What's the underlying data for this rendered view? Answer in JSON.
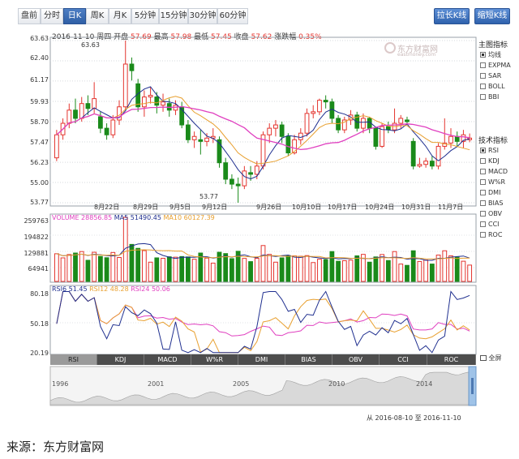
{
  "toolbar": {
    "period_tabs": [
      "盘前",
      "分时",
      "日K",
      "周K",
      "月K",
      "5分钟",
      "15分钟",
      "30分钟",
      "60分钟"
    ],
    "active_tab": "日K",
    "stretch_button": "拉长K线",
    "shorten_button": "缩短K线"
  },
  "ticker": {
    "date": "2016-11-10",
    "weekday": "周四",
    "open_label": "开盘",
    "open": "57.69",
    "high_label": "最高",
    "high": "57.98",
    "low_label": "最低",
    "low": "57.45",
    "close_label": "收盘",
    "close": "57.62",
    "change_label": "涨跌幅",
    "change": "0.35%"
  },
  "watermark": {
    "brand": "东方财富网",
    "domain": "eastmoney.com"
  },
  "price_axis": [
    "63.63",
    "62.40",
    "61.17",
    "59.93",
    "58.70",
    "57.47",
    "56.23",
    "55.00",
    "53.77"
  ],
  "price_annotations": {
    "high": "63.63",
    "low": "53.77"
  },
  "date_axis": [
    "8月22日",
    "8月29日",
    "9月5日",
    "9月12日",
    "9月26日",
    "10月10日",
    "10月17日",
    "10月24日",
    "10月31日",
    "11月7日"
  ],
  "volume_legend": {
    "volume": "VOLUME 28856.85",
    "ma5": "MA5 51490.45",
    "ma10": "MA10 60127.39"
  },
  "volume_axis": [
    "259763",
    "194822",
    "129881",
    "64941"
  ],
  "rsi_legend": {
    "rsi6": "RSI6 51.45",
    "rsi12": "RSI12 48.28",
    "rsi24": "RSI24 50.06"
  },
  "rsi_axis": [
    "80.18",
    "50.18",
    "20.19"
  ],
  "indicator_tabs": [
    "RSI",
    "KDJ",
    "MACD",
    "W%R",
    "DMI",
    "BIAS",
    "OBV",
    "CCI",
    "ROC"
  ],
  "active_indicator": "RSI",
  "fullscreen_label": "全屏",
  "overview_years": [
    "1996",
    "2001",
    "2005",
    "2010",
    "2014"
  ],
  "date_range": {
    "from_label": "从",
    "from": "2016-08-10",
    "to_label": "至",
    "to": "2016-11-10"
  },
  "main_indicators": {
    "title": "主图指标",
    "items": [
      "均线",
      "EXPMA",
      "SAR",
      "BOLL",
      "BBI"
    ],
    "selected": "均线"
  },
  "tech_indicators": {
    "title": "技术指标",
    "items": [
      "RSI",
      "KDJ",
      "MACD",
      "W%R",
      "DMI",
      "BIAS",
      "OBV",
      "CCI",
      "ROC"
    ],
    "selected": "RSI"
  },
  "source_caption": "来源：东方财富网",
  "colors": {
    "up": "#e4352f",
    "down": "#1a8a1a",
    "accent": "#2f5fa6",
    "ma5": "#1f2f8f",
    "ma10": "#e8a030",
    "ma20": "#e040c0"
  },
  "chart_data": {
    "type": "candlestick",
    "price_range": [
      53.77,
      63.63
    ],
    "candles": [
      {
        "o": 56.5,
        "c": 57.9,
        "h": 58.2,
        "l": 56.3
      },
      {
        "o": 57.9,
        "c": 58.6,
        "h": 58.9,
        "l": 57.6
      },
      {
        "o": 58.6,
        "c": 59.4,
        "h": 59.8,
        "l": 58.3
      },
      {
        "o": 59.4,
        "c": 58.9,
        "h": 60.1,
        "l": 58.6
      },
      {
        "o": 58.9,
        "c": 59.8,
        "h": 60.2,
        "l": 58.7
      },
      {
        "o": 59.8,
        "c": 59.5,
        "h": 60.3,
        "l": 59.1
      },
      {
        "o": 59.5,
        "c": 60.1,
        "h": 61.1,
        "l": 59.2
      },
      {
        "o": 59.0,
        "c": 58.3,
        "h": 59.3,
        "l": 58.0
      },
      {
        "o": 58.3,
        "c": 57.9,
        "h": 58.6,
        "l": 57.6
      },
      {
        "o": 57.9,
        "c": 58.8,
        "h": 59.1,
        "l": 57.7
      },
      {
        "o": 58.8,
        "c": 59.6,
        "h": 60.0,
        "l": 58.5
      },
      {
        "o": 59.6,
        "c": 62.2,
        "h": 63.63,
        "l": 59.4
      },
      {
        "o": 62.2,
        "c": 61.8,
        "h": 62.6,
        "l": 61.2
      },
      {
        "o": 61.0,
        "c": 59.6,
        "h": 61.3,
        "l": 59.3
      },
      {
        "o": 59.6,
        "c": 60.2,
        "h": 60.6,
        "l": 59.0
      },
      {
        "o": 60.2,
        "c": 60.3,
        "h": 60.8,
        "l": 59.8
      },
      {
        "o": 60.2,
        "c": 59.7,
        "h": 60.5,
        "l": 59.2
      },
      {
        "o": 59.7,
        "c": 59.9,
        "h": 60.4,
        "l": 59.3
      },
      {
        "o": 59.8,
        "c": 59.4,
        "h": 60.1,
        "l": 59.0
      },
      {
        "o": 59.4,
        "c": 59.7,
        "h": 60.0,
        "l": 59.1
      },
      {
        "o": 59.6,
        "c": 58.5,
        "h": 59.9,
        "l": 58.3
      },
      {
        "o": 58.5,
        "c": 57.6,
        "h": 58.8,
        "l": 57.4
      },
      {
        "o": 57.6,
        "c": 57.8,
        "h": 58.1,
        "l": 57.1
      },
      {
        "o": 57.6,
        "c": 57.5,
        "h": 58.2,
        "l": 56.7
      },
      {
        "o": 57.5,
        "c": 57.7,
        "h": 58.0,
        "l": 57.2
      },
      {
        "o": 57.7,
        "c": 57.8,
        "h": 58.3,
        "l": 57.4
      },
      {
        "o": 57.6,
        "c": 56.2,
        "h": 57.8,
        "l": 55.9
      },
      {
        "o": 56.2,
        "c": 55.2,
        "h": 56.5,
        "l": 54.9
      },
      {
        "o": 55.2,
        "c": 54.9,
        "h": 55.5,
        "l": 54.6
      },
      {
        "o": 54.9,
        "c": 54.8,
        "h": 55.3,
        "l": 53.77
      },
      {
        "o": 54.8,
        "c": 55.7,
        "h": 56.0,
        "l": 54.6
      },
      {
        "o": 55.6,
        "c": 55.5,
        "h": 56.0,
        "l": 55.1
      },
      {
        "o": 55.5,
        "c": 56.0,
        "h": 56.3,
        "l": 55.2
      },
      {
        "o": 56.0,
        "c": 57.9,
        "h": 58.1,
        "l": 55.8
      },
      {
        "o": 57.9,
        "c": 58.3,
        "h": 58.6,
        "l": 57.4
      },
      {
        "o": 58.3,
        "c": 58.5,
        "h": 58.8,
        "l": 57.8
      },
      {
        "o": 58.5,
        "c": 57.8,
        "h": 58.7,
        "l": 57.4
      },
      {
        "o": 57.8,
        "c": 56.8,
        "h": 58.0,
        "l": 56.6
      },
      {
        "o": 56.8,
        "c": 57.6,
        "h": 57.9,
        "l": 56.7
      },
      {
        "o": 57.6,
        "c": 58.0,
        "h": 58.3,
        "l": 57.3
      },
      {
        "o": 58.0,
        "c": 59.2,
        "h": 59.5,
        "l": 57.8
      },
      {
        "o": 59.2,
        "c": 59.3,
        "h": 59.7,
        "l": 58.9
      },
      {
        "o": 59.3,
        "c": 60.0,
        "h": 60.1,
        "l": 59.1
      },
      {
        "o": 60.0,
        "c": 59.9,
        "h": 60.3,
        "l": 59.5
      },
      {
        "o": 59.9,
        "c": 58.9,
        "h": 60.1,
        "l": 58.6
      },
      {
        "o": 58.9,
        "c": 58.2,
        "h": 59.1,
        "l": 58.0
      },
      {
        "o": 58.2,
        "c": 58.8,
        "h": 59.0,
        "l": 58.0
      },
      {
        "o": 58.8,
        "c": 59.1,
        "h": 59.4,
        "l": 58.5
      },
      {
        "o": 59.1,
        "c": 58.3,
        "h": 59.3,
        "l": 58.1
      },
      {
        "o": 58.3,
        "c": 58.9,
        "h": 59.2,
        "l": 58.0
      },
      {
        "o": 58.9,
        "c": 58.3,
        "h": 59.0,
        "l": 58.0
      },
      {
        "o": 58.3,
        "c": 57.2,
        "h": 58.4,
        "l": 57.0
      },
      {
        "o": 57.2,
        "c": 58.4,
        "h": 58.6,
        "l": 57.1
      },
      {
        "o": 58.4,
        "c": 58.2,
        "h": 58.7,
        "l": 58.0
      },
      {
        "o": 58.2,
        "c": 58.6,
        "h": 59.5,
        "l": 58.0
      },
      {
        "o": 58.6,
        "c": 58.9,
        "h": 59.1,
        "l": 58.3
      },
      {
        "o": 58.8,
        "c": 58.7,
        "h": 59.0,
        "l": 58.5
      },
      {
        "o": 57.5,
        "c": 56.0,
        "h": 57.7,
        "l": 55.8
      },
      {
        "o": 56.0,
        "c": 56.1,
        "h": 56.5,
        "l": 55.9
      },
      {
        "o": 56.1,
        "c": 56.3,
        "h": 56.5,
        "l": 55.9
      },
      {
        "o": 56.3,
        "c": 56.0,
        "h": 56.6,
        "l": 55.8
      },
      {
        "o": 56.0,
        "c": 57.2,
        "h": 57.4,
        "l": 55.8
      },
      {
        "o": 57.2,
        "c": 57.4,
        "h": 58.9,
        "l": 57.0
      },
      {
        "o": 57.4,
        "c": 57.8,
        "h": 58.3,
        "l": 57.1
      },
      {
        "o": 57.8,
        "c": 57.5,
        "h": 58.1,
        "l": 57.2
      },
      {
        "o": 57.5,
        "c": 57.9,
        "h": 58.2,
        "l": 57.1
      },
      {
        "o": 57.6,
        "c": 57.7,
        "h": 57.98,
        "l": 57.45
      }
    ],
    "volume_range": [
      0,
      259763
    ],
    "rsi_range": [
      20.19,
      80.18
    ]
  }
}
